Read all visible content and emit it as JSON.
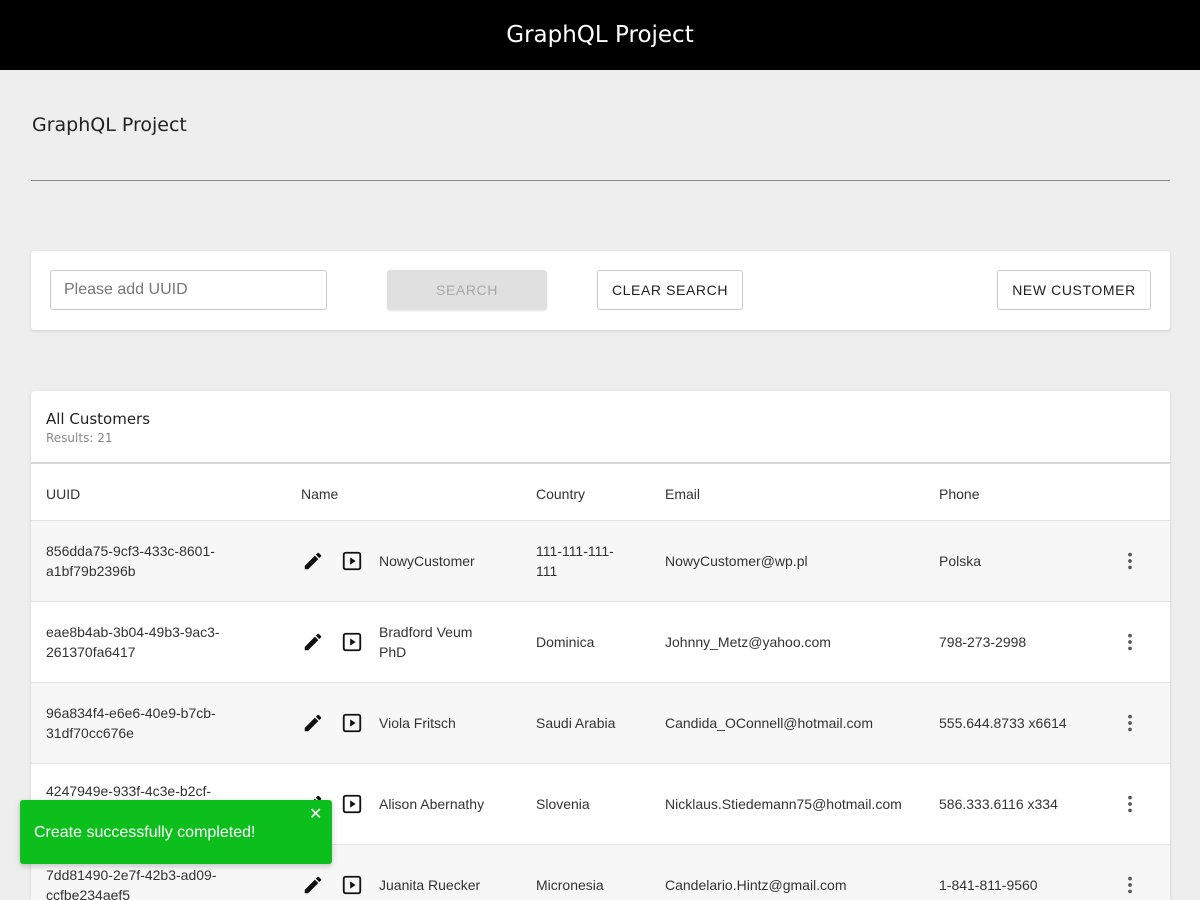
{
  "app": {
    "title": "GraphQL Project"
  },
  "page": {
    "title": "GraphQL Project"
  },
  "search": {
    "placeholder": "Please add UUID",
    "value": "",
    "search_label": "SEARCH",
    "clear_label": "CLEAR SEARCH",
    "new_label": "NEW CUSTOMER"
  },
  "table": {
    "title": "All Customers",
    "results": "Results: 21",
    "columns": {
      "uuid": "UUID",
      "name": "Name",
      "country": "Country",
      "email": "Email",
      "phone": "Phone"
    },
    "rows": [
      {
        "uuid": "856dda75-9cf3-433c-8601-a1bf79b2396b",
        "name": "NowyCustomer",
        "country": "111-111-111-111",
        "email": "NowyCustomer@wp.pl",
        "phone": "Polska"
      },
      {
        "uuid": "eae8b4ab-3b04-49b3-9ac3-261370fa6417",
        "name": "Bradford Veum PhD",
        "country": "Dominica",
        "email": "Johnny_Metz@yahoo.com",
        "phone": "798-273-2998"
      },
      {
        "uuid": "96a834f4-e6e6-40e9-b7cb-31df70cc676e",
        "name": "Viola Fritsch",
        "country": "Saudi Arabia",
        "email": "Candida_OConnell@hotmail.com",
        "phone": "555.644.8733 x6614"
      },
      {
        "uuid": "4247949e-933f-4c3e-b2cf-",
        "name": "Alison Abernathy",
        "country": "Slovenia",
        "email": "Nicklaus.Stiedemann75@hotmail.com",
        "phone": "586.333.6116 x334"
      },
      {
        "uuid": "7dd81490-2e7f-42b3-ad09-ccfbe234aef5",
        "name": "Juanita Ruecker",
        "country": "Micronesia",
        "email": "Candelario.Hintz@gmail.com",
        "phone": "1-841-811-9560"
      }
    ]
  },
  "toast": {
    "message": "Create successfully completed!",
    "close_glyph": "✕"
  },
  "icons": {
    "edit": "pencil-icon",
    "view": "play-box-icon",
    "more": "more-vert-icon",
    "close": "close-icon"
  },
  "colors": {
    "topbar": "#000000",
    "toast": "#0cbf1c",
    "background": "#efeeef"
  }
}
